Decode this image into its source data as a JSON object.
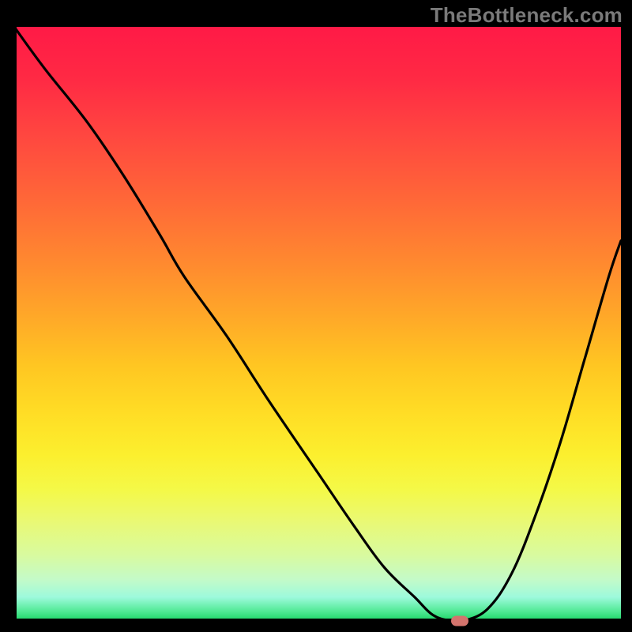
{
  "watermark": "TheBottleneck.com",
  "colors": {
    "curve_stroke": "#000000",
    "marker_fill": "#d4746d",
    "axis": "#000000",
    "gradient_top": "#ff1a46",
    "gradient_bottom": "#19d465"
  },
  "chart_data": {
    "type": "line",
    "title": "",
    "xlabel": "",
    "ylabel": "",
    "xlim": [
      0,
      100
    ],
    "ylim": [
      0,
      100
    ],
    "x": [
      0,
      5,
      12,
      18,
      24,
      28,
      35,
      42,
      50,
      56,
      61,
      66,
      69,
      72,
      74,
      78,
      82,
      86,
      90,
      94,
      98,
      100
    ],
    "y": [
      100,
      93,
      84,
      75,
      65,
      58,
      48,
      37,
      25,
      16,
      9,
      4,
      1,
      0,
      0,
      2,
      8,
      18,
      30,
      44,
      58,
      64
    ],
    "marker": {
      "x": 73.5,
      "y": 0
    },
    "legend": [],
    "annotations": []
  }
}
